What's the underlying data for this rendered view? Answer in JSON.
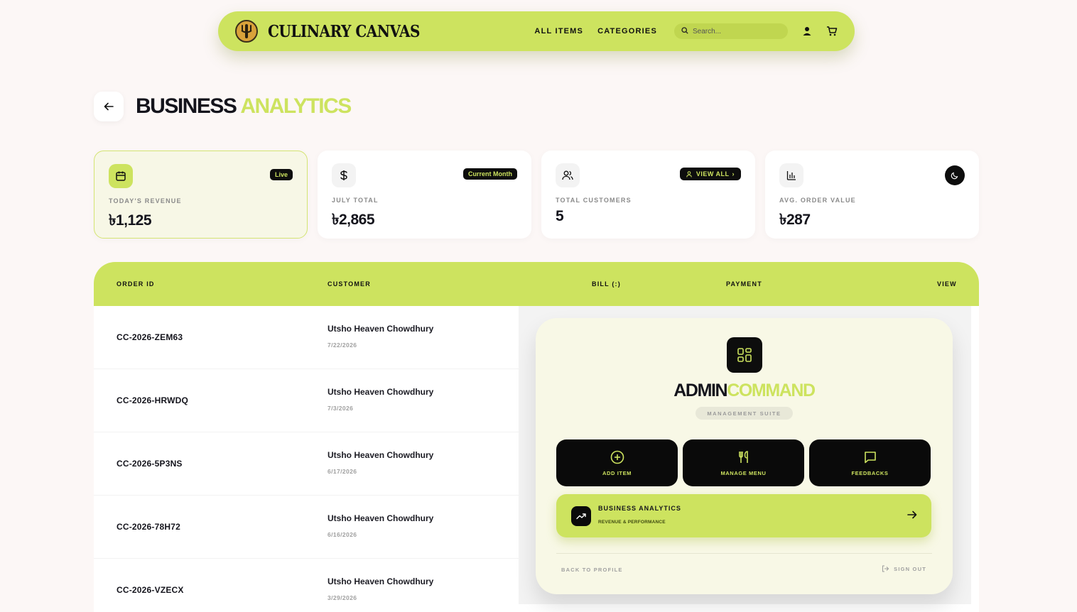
{
  "nav": {
    "brand": "CULINARY CANVAS",
    "links": [
      "ALL ITEMS",
      "CATEGORIES"
    ],
    "search_placeholder": "Search..."
  },
  "header": {
    "title_part1": "BUSINESS",
    "title_part2": "ANALYTICS"
  },
  "stats": [
    {
      "label": "TODAY'S REVENUE",
      "value": "৳1,125",
      "badge": "Live",
      "icon": "calendar-icon"
    },
    {
      "label": "JULY TOTAL",
      "value": "৳2,865",
      "badge": "Current Month",
      "icon": "dollar-icon"
    },
    {
      "label": "TOTAL CUSTOMERS",
      "value": "5",
      "badge": "VIEW ALL",
      "icon": "users-icon"
    },
    {
      "label": "AVG. ORDER VALUE",
      "value": "৳287",
      "icon": "bar-chart-icon"
    }
  ],
  "table": {
    "columns": [
      "ORDER ID",
      "CUSTOMER",
      "BILL (:)",
      "PAYMENT",
      "VIEW"
    ],
    "rows": [
      {
        "order_id": "CC-2026-ZEM63",
        "customer": "Utsho Heaven Chowdhury",
        "date": "7/22/2026"
      },
      {
        "order_id": "CC-2026-HRWDQ",
        "customer": "Utsho Heaven Chowdhury",
        "date": "7/3/2026"
      },
      {
        "order_id": "CC-2026-5P3NS",
        "customer": "Utsho Heaven Chowdhury",
        "date": "6/17/2026"
      },
      {
        "order_id": "CC-2026-78H72",
        "customer": "Utsho Heaven Chowdhury",
        "date": "6/16/2026"
      },
      {
        "order_id": "CC-2026-VZECX",
        "customer": "Utsho Heaven Chowdhury",
        "date": "3/29/2026"
      }
    ]
  },
  "admin": {
    "title_part1": "ADMIN",
    "title_part2": "COMMAND",
    "subtitle": "MANAGEMENT SUITE",
    "actions": [
      "ADD ITEM",
      "MANAGE MENU",
      "FEEDBACKS"
    ],
    "analytics_title": "BUSINESS ANALYTICS",
    "analytics_sub": "REVENUE & PERFORMANCE",
    "back_to_profile": "BACK TO PROFILE",
    "sign_out": "SIGN OUT"
  },
  "colors": {
    "accent": "#cde35f",
    "dark": "#0d0d0d",
    "page_bg": "#fcf7f6"
  }
}
